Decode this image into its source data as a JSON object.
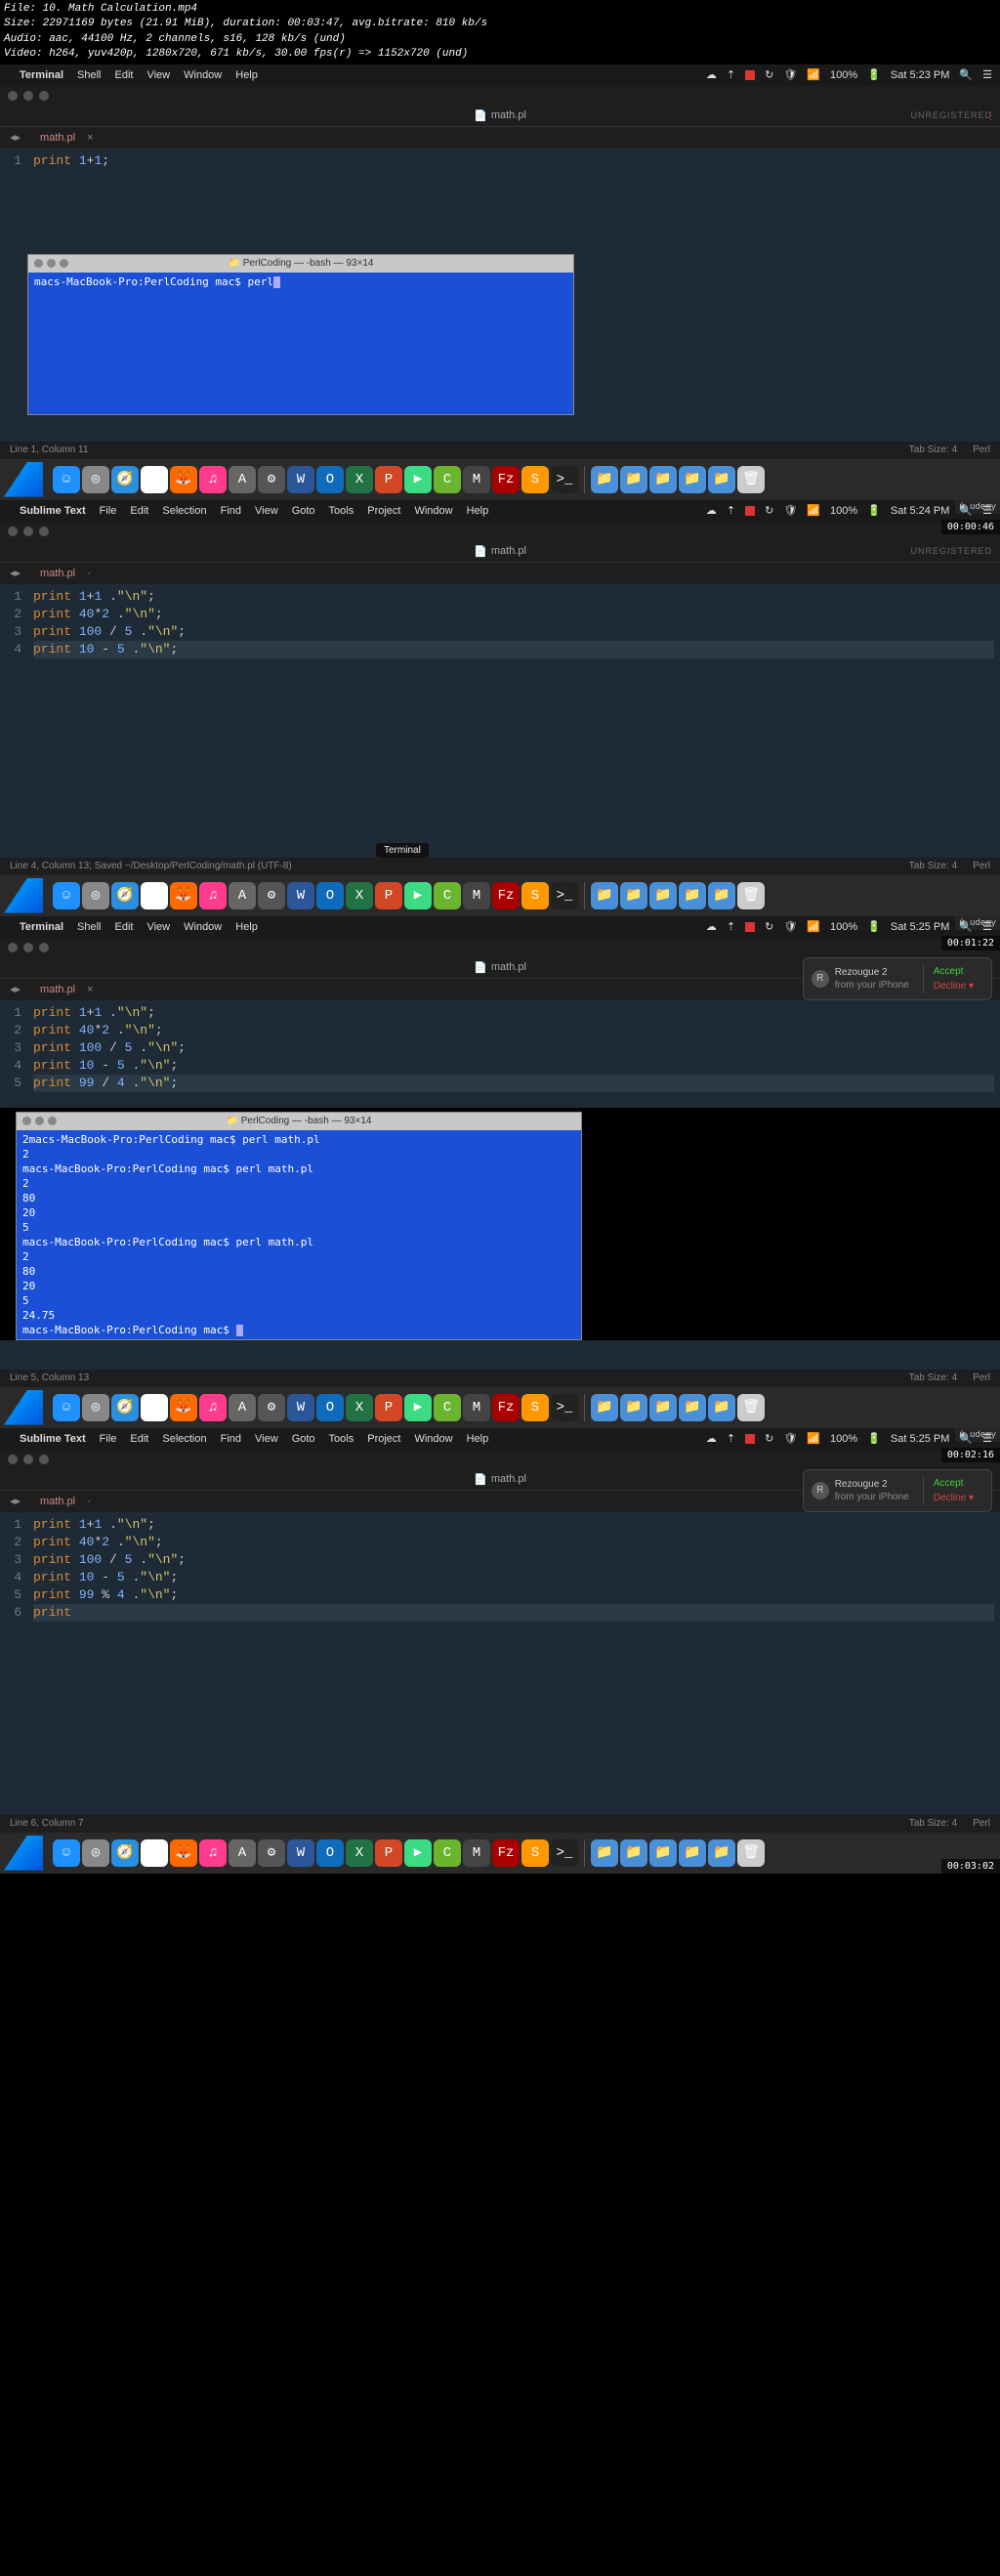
{
  "file_info": {
    "file": "File: 10. Math Calculation.mp4",
    "size": "Size: 22971169 bytes (21.91 MiB), duration: 00:03:47, avg.bitrate: 810 kb/s",
    "audio": "Audio: aac, 44100 Hz, 2 channels, s16, 128 kb/s (und)",
    "video": "Video: h264, yuv420p, 1280x720, 671 kb/s, 30.00 fps(r) => 1152x720 (und)"
  },
  "menubar": {
    "terminal_app": "Terminal",
    "sublime_app": "Sublime Text",
    "menus_terminal": [
      "Shell",
      "Edit",
      "View",
      "Window",
      "Help"
    ],
    "menus_sublime": [
      "File",
      "Edit",
      "Selection",
      "Find",
      "View",
      "Goto",
      "Tools",
      "Project",
      "Window",
      "Help"
    ],
    "battery": "100%",
    "time1": "Sat 5:23 PM",
    "time2": "Sat 5:24 PM",
    "time3": "Sat 5:25 PM",
    "time4": "Sat 5:25 PM"
  },
  "tabs": {
    "filename": "math.pl",
    "unregistered": "UNREGISTERED"
  },
  "code1": {
    "lines": [
      {
        "n": "1",
        "tokens": [
          [
            "kw",
            "print"
          ],
          [
            "op",
            " "
          ],
          [
            "num",
            "1"
          ],
          [
            "op",
            "+"
          ],
          [
            "num",
            "1"
          ],
          [
            "punc",
            ";"
          ]
        ]
      }
    ]
  },
  "terminal1": {
    "title": "PerlCoding — -bash — 93×14",
    "prompt": "macs-MacBook-Pro:PerlCoding mac$ perl"
  },
  "code2": {
    "lines": [
      {
        "n": "1",
        "tokens": [
          [
            "kw",
            "print"
          ],
          [
            "op",
            " "
          ],
          [
            "num",
            "1"
          ],
          [
            "op",
            "+"
          ],
          [
            "num",
            "1"
          ],
          [
            "op",
            " ."
          ],
          [
            "str",
            "\"\\n\""
          ],
          [
            "punc",
            ";"
          ]
        ]
      },
      {
        "n": "2",
        "tokens": [
          [
            "kw",
            "print"
          ],
          [
            "op",
            " "
          ],
          [
            "num",
            "40"
          ],
          [
            "op",
            "*"
          ],
          [
            "num",
            "2"
          ],
          [
            "op",
            " ."
          ],
          [
            "str",
            "\"\\n\""
          ],
          [
            "punc",
            ";"
          ]
        ]
      },
      {
        "n": "3",
        "tokens": [
          [
            "kw",
            "print"
          ],
          [
            "op",
            " "
          ],
          [
            "num",
            "100"
          ],
          [
            "op",
            " / "
          ],
          [
            "num",
            "5"
          ],
          [
            "op",
            " ."
          ],
          [
            "str",
            "\"\\n\""
          ],
          [
            "punc",
            ";"
          ]
        ]
      },
      {
        "n": "4",
        "tokens": [
          [
            "kw",
            "print"
          ],
          [
            "op",
            " "
          ],
          [
            "num",
            "10"
          ],
          [
            "op",
            " - "
          ],
          [
            "num",
            "5"
          ],
          [
            "op",
            " ."
          ],
          [
            "str",
            "\"\\n\""
          ],
          [
            "punc",
            ";"
          ]
        ]
      }
    ]
  },
  "code3": {
    "lines": [
      {
        "n": "1",
        "tokens": [
          [
            "kw",
            "print"
          ],
          [
            "op",
            " "
          ],
          [
            "num",
            "1"
          ],
          [
            "op",
            "+"
          ],
          [
            "num",
            "1"
          ],
          [
            "op",
            " ."
          ],
          [
            "str",
            "\"\\n\""
          ],
          [
            "punc",
            ";"
          ]
        ]
      },
      {
        "n": "2",
        "tokens": [
          [
            "kw",
            "print"
          ],
          [
            "op",
            " "
          ],
          [
            "num",
            "40"
          ],
          [
            "op",
            "*"
          ],
          [
            "num",
            "2"
          ],
          [
            "op",
            " ."
          ],
          [
            "str",
            "\"\\n\""
          ],
          [
            "punc",
            ";"
          ]
        ]
      },
      {
        "n": "3",
        "tokens": [
          [
            "kw",
            "print"
          ],
          [
            "op",
            " "
          ],
          [
            "num",
            "100"
          ],
          [
            "op",
            " / "
          ],
          [
            "num",
            "5"
          ],
          [
            "op",
            " ."
          ],
          [
            "str",
            "\"\\n\""
          ],
          [
            "punc",
            ";"
          ]
        ]
      },
      {
        "n": "4",
        "tokens": [
          [
            "kw",
            "print"
          ],
          [
            "op",
            " "
          ],
          [
            "num",
            "10"
          ],
          [
            "op",
            " - "
          ],
          [
            "num",
            "5"
          ],
          [
            "op",
            " ."
          ],
          [
            "str",
            "\"\\n\""
          ],
          [
            "punc",
            ";"
          ]
        ]
      },
      {
        "n": "5",
        "tokens": [
          [
            "kw",
            "print"
          ],
          [
            "op",
            " "
          ],
          [
            "num",
            "99"
          ],
          [
            "op",
            " / "
          ],
          [
            "num",
            "4"
          ],
          [
            "op",
            " ."
          ],
          [
            "str",
            "\"\\n\""
          ],
          [
            "punc",
            ";"
          ]
        ]
      }
    ]
  },
  "terminal3": {
    "title": "PerlCoding — -bash — 93×14",
    "lines": [
      "2macs-MacBook-Pro:PerlCoding mac$ perl math.pl",
      "2",
      "macs-MacBook-Pro:PerlCoding mac$ perl math.pl",
      "2",
      "80",
      "20",
      "5",
      "macs-MacBook-Pro:PerlCoding mac$ perl math.pl",
      "2",
      "80",
      "20",
      "5",
      "24.75",
      "macs-MacBook-Pro:PerlCoding mac$ "
    ]
  },
  "code4": {
    "lines": [
      {
        "n": "1",
        "tokens": [
          [
            "kw",
            "print"
          ],
          [
            "op",
            " "
          ],
          [
            "num",
            "1"
          ],
          [
            "op",
            "+"
          ],
          [
            "num",
            "1"
          ],
          [
            "op",
            " ."
          ],
          [
            "str",
            "\"\\n\""
          ],
          [
            "punc",
            ";"
          ]
        ]
      },
      {
        "n": "2",
        "tokens": [
          [
            "kw",
            "print"
          ],
          [
            "op",
            " "
          ],
          [
            "num",
            "40"
          ],
          [
            "op",
            "*"
          ],
          [
            "num",
            "2"
          ],
          [
            "op",
            " ."
          ],
          [
            "str",
            "\"\\n\""
          ],
          [
            "punc",
            ";"
          ]
        ]
      },
      {
        "n": "3",
        "tokens": [
          [
            "kw",
            "print"
          ],
          [
            "op",
            " "
          ],
          [
            "num",
            "100"
          ],
          [
            "op",
            " / "
          ],
          [
            "num",
            "5"
          ],
          [
            "op",
            " ."
          ],
          [
            "str",
            "\"\\n\""
          ],
          [
            "punc",
            ";"
          ]
        ]
      },
      {
        "n": "4",
        "tokens": [
          [
            "kw",
            "print"
          ],
          [
            "op",
            " "
          ],
          [
            "num",
            "10"
          ],
          [
            "op",
            " - "
          ],
          [
            "num",
            "5"
          ],
          [
            "op",
            " ."
          ],
          [
            "str",
            "\"\\n\""
          ],
          [
            "punc",
            ";"
          ]
        ]
      },
      {
        "n": "5",
        "tokens": [
          [
            "kw",
            "print"
          ],
          [
            "op",
            " "
          ],
          [
            "num",
            "99"
          ],
          [
            "op",
            " % "
          ],
          [
            "num",
            "4"
          ],
          [
            "op",
            " ."
          ],
          [
            "str",
            "\"\\n\""
          ],
          [
            "punc",
            ";"
          ]
        ]
      },
      {
        "n": "6",
        "tokens": [
          [
            "kw",
            "print"
          ],
          [
            "op",
            " "
          ]
        ]
      }
    ]
  },
  "status": {
    "s1": "Line 1, Column 11",
    "s2": "Line 4, Column 13; Saved ~/Desktop/PerlCoding/math.pl (UTF-8)",
    "s3": "Line 5, Column 13",
    "s4": "Line 6, Column 7",
    "tab_size": "Tab Size: 4",
    "lang": "Perl"
  },
  "notif": {
    "title": "Rezougue 2",
    "sub": "from your iPhone",
    "accept": "Accept",
    "decline": "Decline ▾"
  },
  "tooltip": "Terminal",
  "timestamps": {
    "t1": "00:00:46",
    "t2": "00:01:22",
    "t3": "00:02:16",
    "t4": "00:03:02"
  },
  "dock_icons": [
    {
      "name": "finder",
      "bg": "#1e90ff",
      "char": "☺"
    },
    {
      "name": "launchpad",
      "bg": "#888",
      "char": "◎"
    },
    {
      "name": "safari",
      "bg": "#2a8fe0",
      "char": "🧭"
    },
    {
      "name": "chrome",
      "bg": "#fff",
      "char": "◉"
    },
    {
      "name": "firefox",
      "bg": "#ff6a00",
      "char": "🦊"
    },
    {
      "name": "itunes",
      "bg": "#ff3b8d",
      "char": "♫"
    },
    {
      "name": "appstore",
      "bg": "#666",
      "char": "A"
    },
    {
      "name": "settings",
      "bg": "#555",
      "char": "⚙"
    },
    {
      "name": "word",
      "bg": "#2b579a",
      "char": "W"
    },
    {
      "name": "outlook",
      "bg": "#0f6cbd",
      "char": "O"
    },
    {
      "name": "excel",
      "bg": "#217346",
      "char": "X"
    },
    {
      "name": "powerpoint",
      "bg": "#d24726",
      "char": "P"
    },
    {
      "name": "android",
      "bg": "#3ddc84",
      "char": "▶"
    },
    {
      "name": "camtasia",
      "bg": "#6ab42e",
      "char": "C"
    },
    {
      "name": "mamp",
      "bg": "#444",
      "char": "M"
    },
    {
      "name": "filezilla",
      "bg": "#a00",
      "char": "Fz"
    },
    {
      "name": "sublime",
      "bg": "#ff9800",
      "char": "S"
    },
    {
      "name": "terminal",
      "bg": "#222",
      "char": ">_"
    }
  ],
  "dock_right": [
    {
      "name": "folder1",
      "bg": "#4a90d9",
      "char": "📁"
    },
    {
      "name": "folder2",
      "bg": "#4a90d9",
      "char": "📁"
    },
    {
      "name": "folder3",
      "bg": "#4a90d9",
      "char": "📁"
    },
    {
      "name": "folder4",
      "bg": "#4a90d9",
      "char": "📁"
    },
    {
      "name": "folder5",
      "bg": "#4a90d9",
      "char": "📁"
    },
    {
      "name": "trash",
      "bg": "#ccc",
      "char": "🗑"
    }
  ]
}
